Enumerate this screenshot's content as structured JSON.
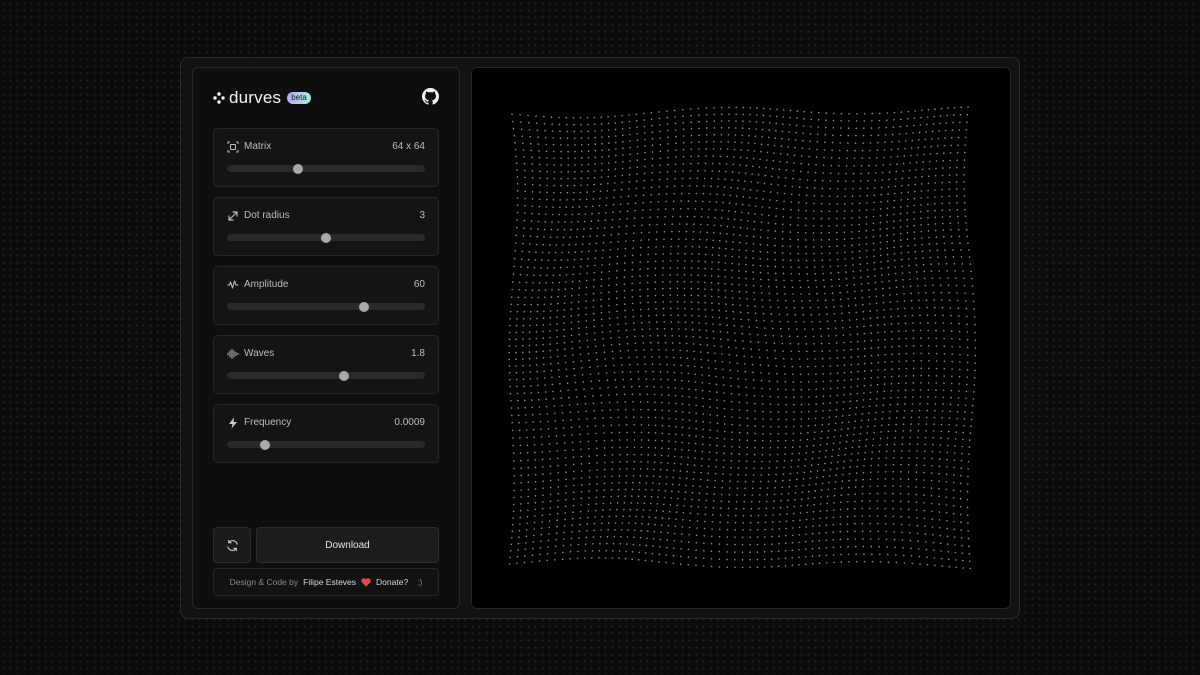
{
  "brand": {
    "name": "durves",
    "badge": "beta",
    "logo_icon": "dots-logo-icon",
    "github_icon": "github-icon"
  },
  "controls": [
    {
      "id": "matrix",
      "label": "Matrix",
      "value": "64 x 64",
      "icon": "matrix-icon",
      "slider_fraction": 0.36
    },
    {
      "id": "dot-radius",
      "label": "Dot radius",
      "value": "3",
      "icon": "diagonal-arrow-icon",
      "slider_fraction": 0.5
    },
    {
      "id": "amplitude",
      "label": "Amplitude",
      "value": "60",
      "icon": "pulse-icon",
      "slider_fraction": 0.69
    },
    {
      "id": "waves",
      "label": "Waves",
      "value": "1.8",
      "icon": "waveform-icon",
      "slider_fraction": 0.59
    },
    {
      "id": "frequency",
      "label": "Frequency",
      "value": "0.0009",
      "icon": "lightning-icon",
      "slider_fraction": 0.19
    }
  ],
  "actions": {
    "refresh_icon": "refresh-icon",
    "download_label": "Download"
  },
  "credits": {
    "prefix": "Design & Code by",
    "author": "Filipe Esteves",
    "heart_icon": "heart-icon",
    "donate": "Donate?",
    "smile": ":)"
  },
  "colors": {
    "background": "#0b0b0b",
    "panel": "#0e0e0e",
    "preview": "#000000",
    "accent_gradient_start": "#b7a7ff",
    "accent_gradient_end": "#a4f0d4",
    "heart": "#e5484d"
  }
}
